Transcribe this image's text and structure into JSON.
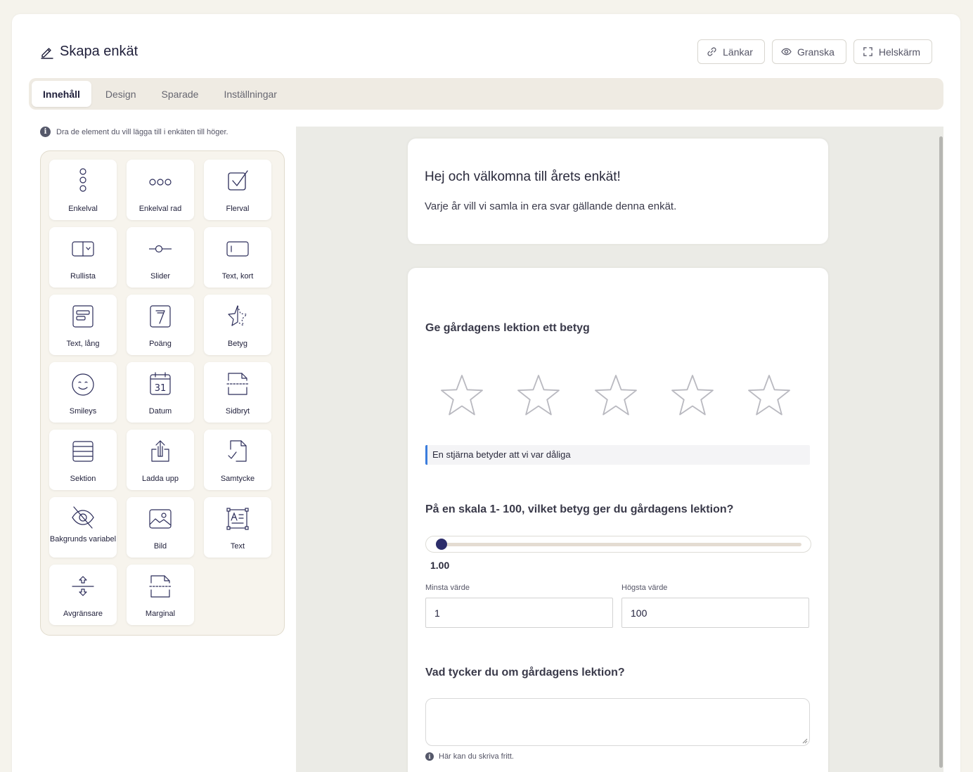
{
  "header": {
    "title": "Skapa enkät",
    "buttons": {
      "links": "Länkar",
      "preview": "Granska",
      "fullscreen": "Helskärm"
    }
  },
  "tabs": [
    {
      "label": "Innehåll",
      "active": true
    },
    {
      "label": "Design",
      "active": false
    },
    {
      "label": "Sparade",
      "active": false
    },
    {
      "label": "Inställningar",
      "active": false
    }
  ],
  "sidebar": {
    "hint": "Dra de element du vill lägga till i enkäten till höger.",
    "items": [
      {
        "label": "Enkelval",
        "icon": "radio-vertical-icon"
      },
      {
        "label": "Enkelval rad",
        "icon": "radio-row-icon"
      },
      {
        "label": "Flerval",
        "icon": "checkbox-icon"
      },
      {
        "label": "Rullista",
        "icon": "dropdown-icon"
      },
      {
        "label": "Slider",
        "icon": "slider-icon"
      },
      {
        "label": "Text, kort",
        "icon": "text-short-icon"
      },
      {
        "label": "Text, lång",
        "icon": "text-long-icon"
      },
      {
        "label": "Poäng",
        "icon": "score-icon"
      },
      {
        "label": "Betyg",
        "icon": "star-rating-icon"
      },
      {
        "label": "Smileys",
        "icon": "smiley-icon"
      },
      {
        "label": "Datum",
        "icon": "calendar-icon"
      },
      {
        "label": "Sidbryt",
        "icon": "page-break-icon"
      },
      {
        "label": "Sektion",
        "icon": "section-icon"
      },
      {
        "label": "Ladda upp",
        "icon": "upload-icon"
      },
      {
        "label": "Samtycke",
        "icon": "consent-icon"
      },
      {
        "label": "Bakgrunds variabel",
        "icon": "eye-off-icon"
      },
      {
        "label": "Bild",
        "icon": "image-icon"
      },
      {
        "label": "Text",
        "icon": "text-block-icon"
      },
      {
        "label": "Avgränsare",
        "icon": "divider-icon"
      },
      {
        "label": "Marginal",
        "icon": "margin-icon"
      }
    ]
  },
  "survey": {
    "welcome": {
      "title": "Hej och välkomna till årets enkät!",
      "text": "Varje år vill vi samla in era svar gällande denna enkät."
    },
    "rating": {
      "question": "Ge gårdagens lektion ett betyg",
      "stars": 5,
      "selected": 0,
      "note": "En stjärna betyder att vi var dåliga"
    },
    "slider": {
      "question": "På en skala 1- 100, vilket betyg ger du gårdagens lektion?",
      "value": 1,
      "display": "1.00",
      "min_label": "Minsta värde",
      "min": "1",
      "max_label": "Högsta värde",
      "max": "100"
    },
    "open": {
      "question": "Vad tycker du om gårdagens lektion?",
      "value": "",
      "help": "Här kan du skriva fritt."
    }
  },
  "colors": {
    "accent": "#2c2d6a",
    "note_border": "#3b7ddd",
    "tab_bar": "#efebe3",
    "canvas": "#ebebe6"
  }
}
